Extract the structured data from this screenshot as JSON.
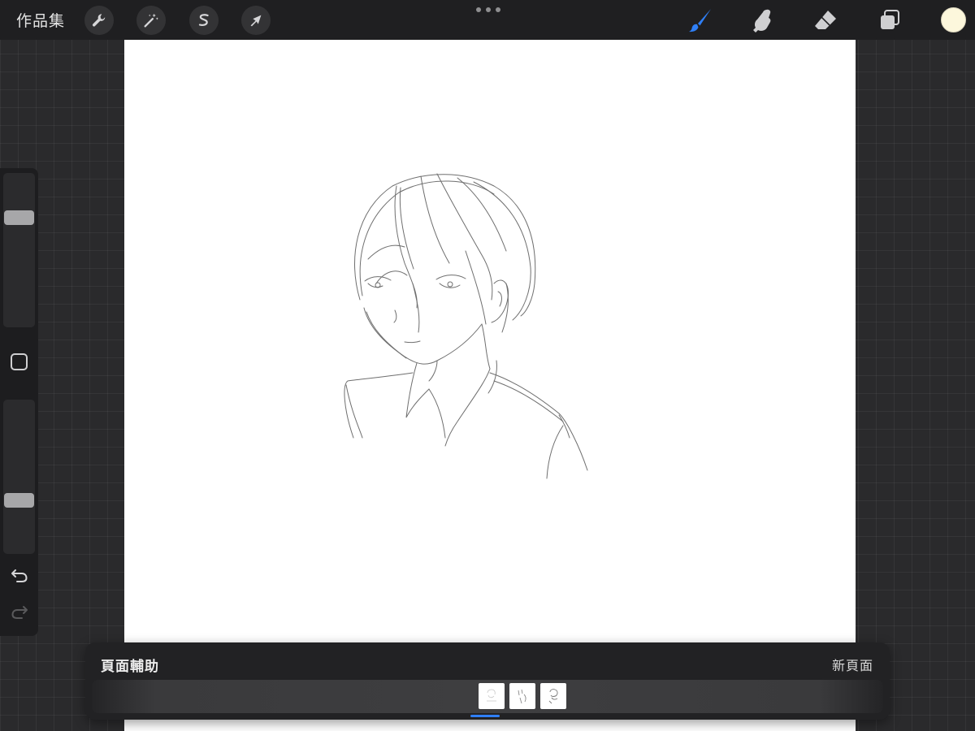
{
  "toolbar": {
    "gallery_label": "作品集",
    "left_tools": [
      {
        "name": "actions-wrench",
        "icon": "wrench-icon"
      },
      {
        "name": "adjustments",
        "icon": "magic-wand-icon"
      },
      {
        "name": "selection",
        "icon": "selection-s-icon"
      },
      {
        "name": "transform",
        "icon": "arrow-cursor-icon"
      }
    ],
    "right_tools": [
      {
        "name": "brush",
        "icon": "brush-icon",
        "active": true
      },
      {
        "name": "smudge",
        "icon": "smudge-finger-icon",
        "active": false
      },
      {
        "name": "eraser",
        "icon": "eraser-icon",
        "active": false
      },
      {
        "name": "layers",
        "icon": "layers-icon",
        "active": false
      }
    ],
    "current_color": "#fcf7dc",
    "accent_color": "#2f7ff6"
  },
  "sidebar": {
    "brush_size_level": 0.73,
    "opacity_level": 0.33,
    "modify_icon": "square-icon",
    "undo_icon": "undo-arrow-icon",
    "redo_icon": "redo-arrow-icon"
  },
  "page_assist": {
    "title": "頁面輔助",
    "new_page_label": "新頁面",
    "pages": [
      {
        "label": "",
        "active": true
      },
      {
        "label": "",
        "active": false
      },
      {
        "label": "",
        "active": false
      }
    ]
  }
}
